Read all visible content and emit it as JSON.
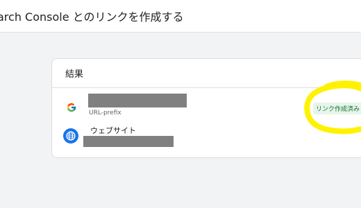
{
  "header": {
    "title": "arch Console とのリンクを作成する"
  },
  "card": {
    "title": "結果",
    "property": {
      "type_label": "URL-prefix",
      "icon": "google-g-icon"
    },
    "website": {
      "label": "ウェブサイト",
      "icon": "globe-icon"
    },
    "status": {
      "label": "リンク作成済み",
      "color": "#137333"
    }
  },
  "annotation": {
    "color": "#fff200"
  }
}
